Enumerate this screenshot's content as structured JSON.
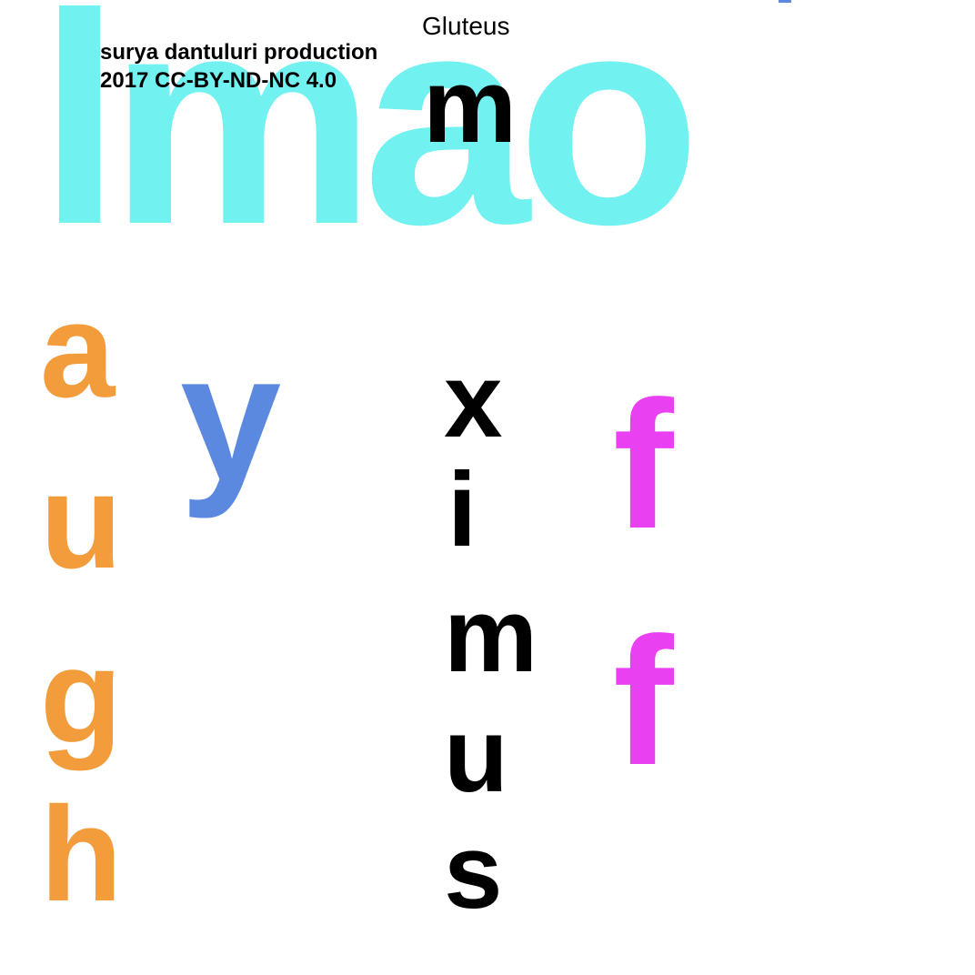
{
  "colors": {
    "cyan": "#72f1f1",
    "orange": "#f29c3b",
    "blue": "#5c89e0",
    "magenta": "#e940f2",
    "black": "#000000"
  },
  "headline": "lmao",
  "credits": {
    "line1": "surya dantuluri production",
    "line2": "2017 CC-BY-ND-NC 4.0"
  },
  "gluteus": "Gluteus",
  "columns": {
    "laugh": [
      "a",
      "u",
      "g",
      "h"
    ],
    "y": "y",
    "maximus": [
      "m",
      "x",
      "i",
      "m",
      "u",
      "s"
    ],
    "off": [
      "f",
      "f"
    ]
  }
}
